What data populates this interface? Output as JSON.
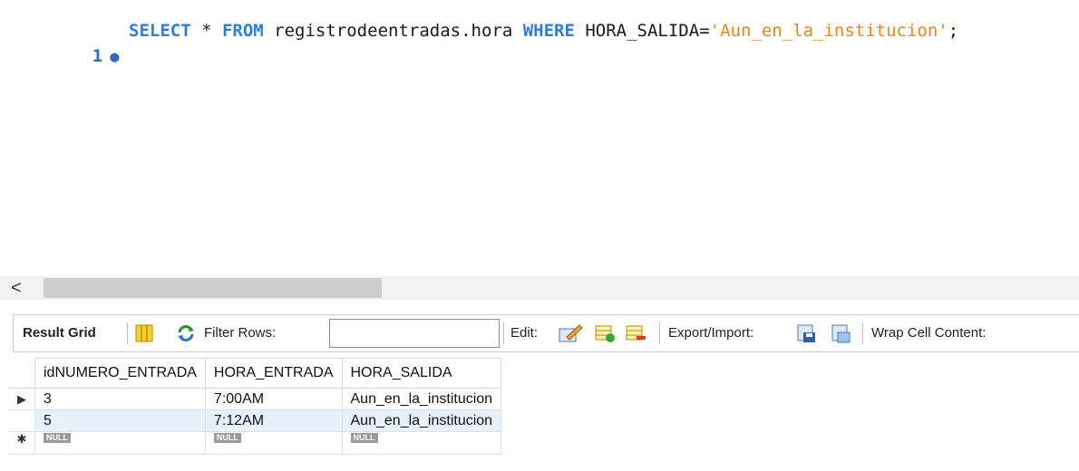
{
  "editor": {
    "line_number": "1",
    "tokens": {
      "select": "SELECT",
      "star": " * ",
      "from": "FROM",
      "table": " registrodeentradas.hora ",
      "where": "WHERE",
      "column": " HORA_SALIDA=",
      "value": "'Aun_en_la_institucion'",
      "end": ";"
    }
  },
  "scroll": {
    "left_arrow": "<"
  },
  "toolbar": {
    "result_grid_label": "Result Grid",
    "filter_label": "Filter Rows:",
    "filter_value": "",
    "edit_label": "Edit:",
    "export_label": "Export/Import:",
    "wrap_label": "Wrap Cell Content:"
  },
  "grid": {
    "columns": [
      "idNUMERO_ENTRADA",
      "HORA_ENTRADA",
      "HORA_SALIDA"
    ],
    "rows": [
      [
        "3",
        "7:00AM",
        "Aun_en_la_institucion"
      ],
      [
        "5",
        "7:12AM",
        "Aun_en_la_institucion"
      ]
    ],
    "null_label": "NULL",
    "current_row_marker": "▶",
    "new_row_marker": "✱"
  },
  "colors": {
    "keyword": "#2f7fd6",
    "string": "#e08a16",
    "selected_row": "#e8f0fb"
  }
}
